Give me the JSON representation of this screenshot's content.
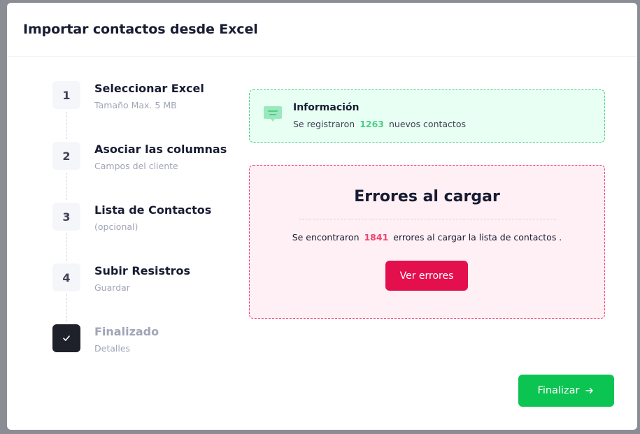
{
  "modal": {
    "title": "Importar contactos desde Excel"
  },
  "steps": [
    {
      "number": "1",
      "title": "Seleccionar Excel",
      "subtitle": "Tamaño Max. 5 MB"
    },
    {
      "number": "2",
      "title": "Asociar las columnas",
      "subtitle": "Campos del cliente"
    },
    {
      "number": "3",
      "title": "Lista de Contactos",
      "subtitle": "(opcional)"
    },
    {
      "number": "4",
      "title": "Subir Resistros",
      "subtitle": "Guardar"
    },
    {
      "number": "",
      "title": "Finalizado",
      "subtitle": "Detalles",
      "icon": "check-icon"
    }
  ],
  "info": {
    "icon": "message-icon",
    "title": "Información",
    "text_before": "Se registraron",
    "count": "1263",
    "text_after": "nuevos contactos"
  },
  "errors": {
    "title": "Errores al cargar",
    "text_before": "Se encontraron",
    "count": "1841",
    "text_after": "errores al cargar la lista de contactos .",
    "button_label": "Ver errores"
  },
  "footer": {
    "finish_label": "Finalizar",
    "finish_icon": "arrow-right-icon"
  },
  "colors": {
    "success": "#50cd89",
    "danger": "#f1416c",
    "primary_button": "#0cc452",
    "danger_button": "#e4104d"
  }
}
